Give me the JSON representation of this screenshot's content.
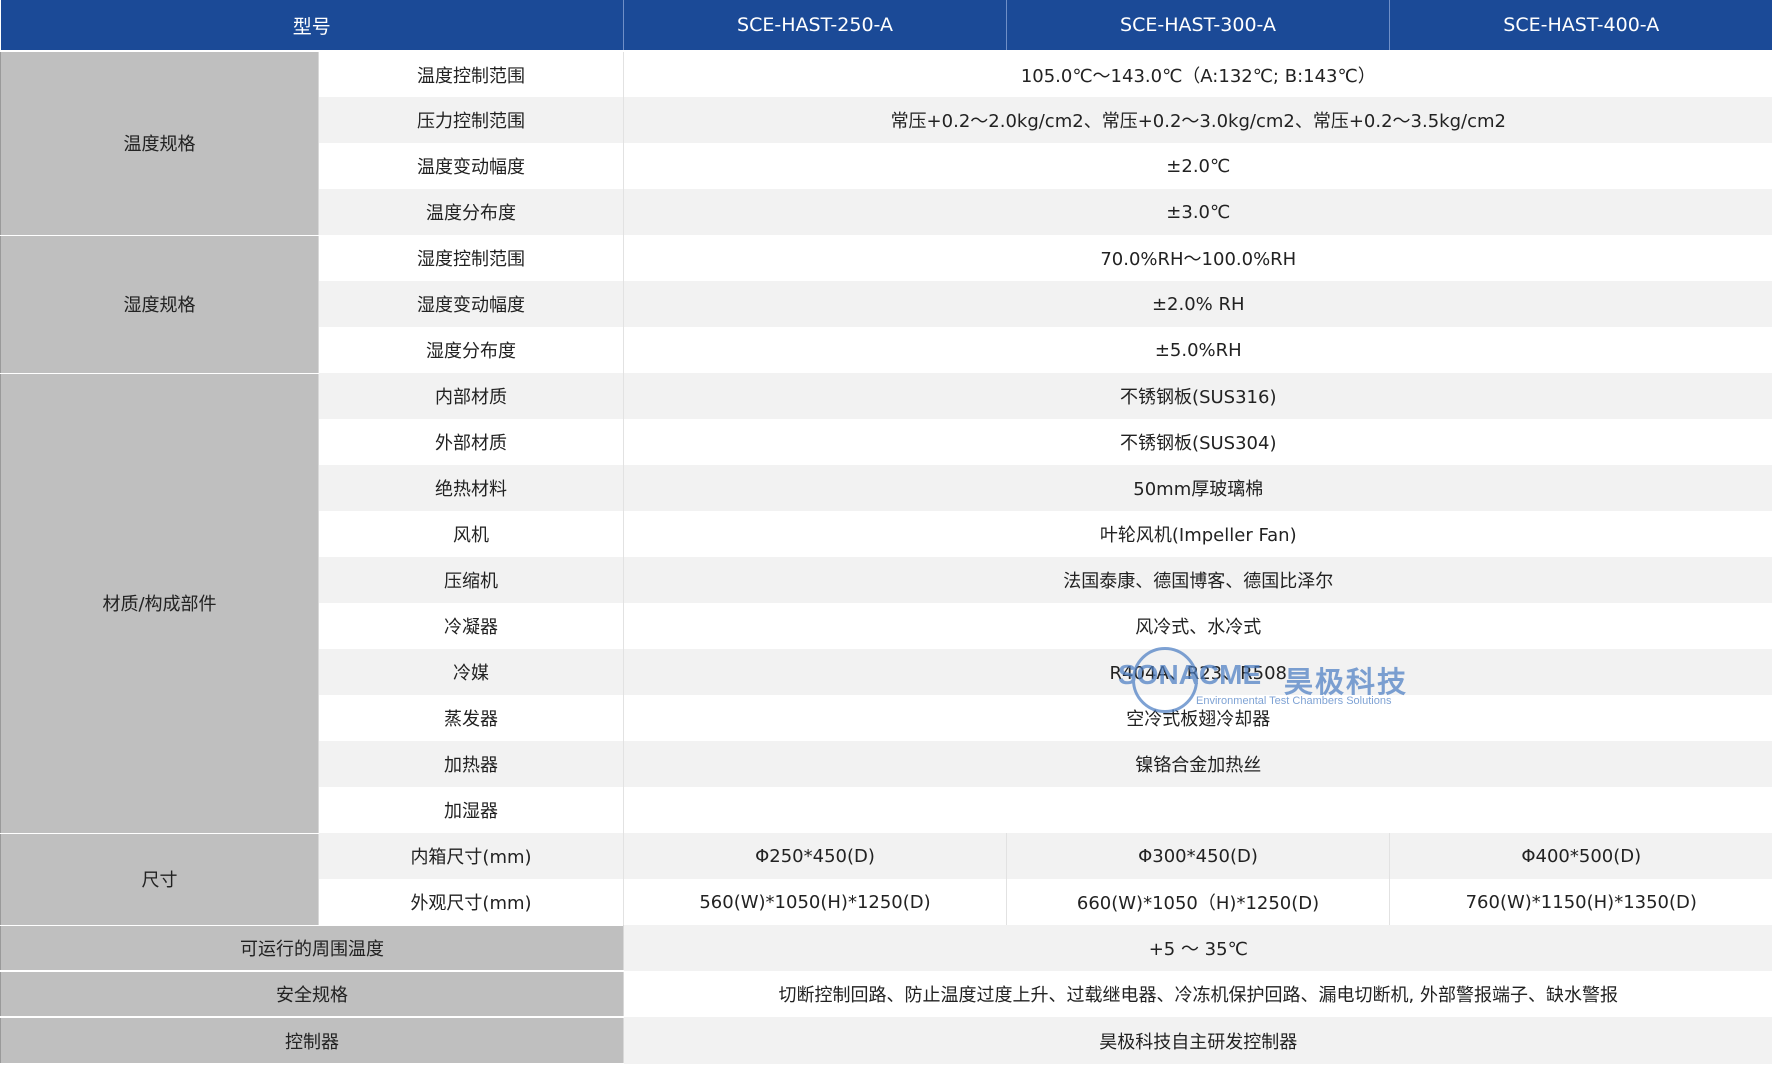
{
  "header": {
    "model_label": "型号",
    "models": [
      "SCE-HAST-250-A",
      "SCE-HAST-300-A",
      "SCE-HAST-400-A"
    ]
  },
  "groups": [
    {
      "category": "温度规格",
      "rows": [
        {
          "item": "温度控制范围",
          "value": "105.0℃～143.0℃（A:132℃; B:143℃）"
        },
        {
          "item": "压力控制范围",
          "value": "常压+0.2～2.0kg/cm2、常压+0.2～3.0kg/cm2、常压+0.2～3.5kg/cm2"
        },
        {
          "item": "温度变动幅度",
          "value": "±2.0℃"
        },
        {
          "item": "温度分布度",
          "value": "±3.0℃"
        }
      ]
    },
    {
      "category": "湿度规格",
      "rows": [
        {
          "item": "湿度控制范围",
          "value": "70.0%RH～100.0%RH"
        },
        {
          "item": "湿度变动幅度",
          "value": "±2.0% RH"
        },
        {
          "item": "湿度分布度",
          "value": "±5.0%RH"
        }
      ]
    },
    {
      "category": "材质/构成部件",
      "rows": [
        {
          "item": "内部材质",
          "value": "不锈钢板(SUS316)"
        },
        {
          "item": "外部材质",
          "value": "不锈钢板(SUS304)"
        },
        {
          "item": "绝热材料",
          "value": "50mm厚玻璃棉"
        },
        {
          "item": "风机",
          "value": "叶轮风机(Impeller Fan)"
        },
        {
          "item": "压缩机",
          "value": "法国泰康、德国博客、德国比泽尔"
        },
        {
          "item": "冷凝器",
          "value": "风冷式、水冷式"
        },
        {
          "item": "冷媒",
          "value": "R404A、R23、R508"
        },
        {
          "item": "蒸发器",
          "value": "空冷式板翅冷却器"
        },
        {
          "item": "加热器",
          "value": "镍铬合金加热丝"
        },
        {
          "item": "加湿器",
          "value": ""
        }
      ]
    },
    {
      "category": "尺寸",
      "rows": [
        {
          "item": "内箱尺寸(mm)",
          "values": [
            "Φ250*450(D)",
            "Φ300*450(D)",
            "Φ400*500(D)"
          ]
        },
        {
          "item": "外观尺寸(mm)",
          "values": [
            "560(W)*1050(H)*1250(D)",
            "660(W)*1050（H)*1250(D)",
            "760(W)*1150(H)*1350(D)"
          ]
        }
      ]
    }
  ],
  "footer_rows": [
    {
      "label": "可运行的周围温度",
      "value": "+5 ～ 35℃"
    },
    {
      "label": "安全规格",
      "value": "切断控制回路、防止温度过度上升、过载继电器、冷冻机保护回路、漏电切断机, 外部警报端子、缺水警报"
    },
    {
      "label": "控制器",
      "value": "昊极科技自主研发控制器"
    }
  ],
  "watermark": {
    "brand_en": "SONACME",
    "brand_cn": "昊极科技",
    "tagline": "Environmental Test Chambers Solutions"
  }
}
